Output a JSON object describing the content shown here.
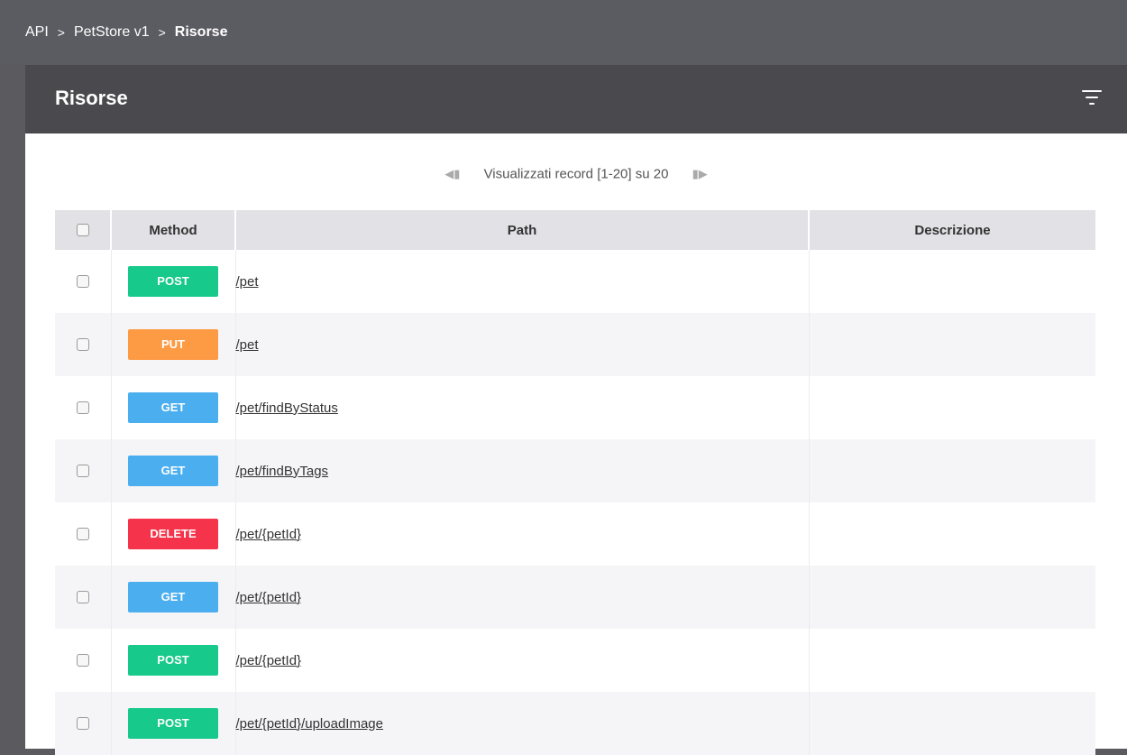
{
  "breadcrumb": {
    "items": [
      "API",
      "PetStore v1"
    ],
    "current": "Risorse",
    "separator": ">"
  },
  "panel": {
    "title": "Risorse",
    "filter_icon": "filter-icon"
  },
  "pager": {
    "text": "Visualizzati record [1-20] su 20",
    "first_icon": "first-page-icon",
    "last_icon": "last-page-icon"
  },
  "table": {
    "headers": {
      "method": "Method",
      "path": "Path",
      "description": "Descrizione"
    },
    "rows": [
      {
        "method": "POST",
        "method_color": "#18c98c",
        "path": "/pet",
        "description": ""
      },
      {
        "method": "PUT",
        "method_color": "#fd9b44",
        "path": "/pet",
        "description": ""
      },
      {
        "method": "GET",
        "method_color": "#4aaeef",
        "path": "/pet/findByStatus",
        "description": ""
      },
      {
        "method": "GET",
        "method_color": "#4aaeef",
        "path": "/pet/findByTags",
        "description": ""
      },
      {
        "method": "DELETE",
        "method_color": "#f5334a",
        "path": "/pet/{petId}",
        "description": ""
      },
      {
        "method": "GET",
        "method_color": "#4aaeef",
        "path": "/pet/{petId}",
        "description": ""
      },
      {
        "method": "POST",
        "method_color": "#18c98c",
        "path": "/pet/{petId}",
        "description": ""
      },
      {
        "method": "POST",
        "method_color": "#18c98c",
        "path": "/pet/{petId}/uploadImage",
        "description": ""
      }
    ]
  }
}
